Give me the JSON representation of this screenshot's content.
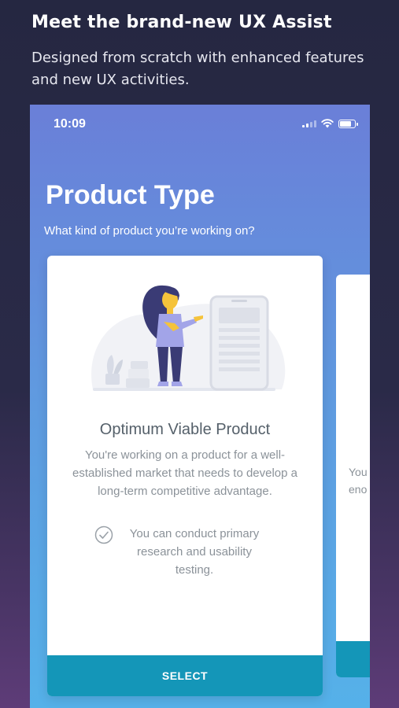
{
  "promo": {
    "title": "Meet the brand-new UX Assist",
    "subtitle": "Designed from scratch with enhanced features and new UX activities."
  },
  "status_bar": {
    "time": "10:09",
    "icons": [
      "signal-icon",
      "wifi-icon",
      "battery-icon"
    ]
  },
  "screen": {
    "title": "Product Type",
    "subtitle": "What kind of product you’re working on?"
  },
  "card": {
    "title": "Optimum Viable Product",
    "description": "You're working on a product for a well-established market that needs to develop a long-term competitive advantage.",
    "benefit": "You can conduct primary research and usability testing.",
    "button_label": "SELECT"
  },
  "peek_card": {
    "line1": "You",
    "line2": "eno"
  },
  "colors": {
    "accent": "#1496b8",
    "phone_gradient_top": "#6a7fd8",
    "phone_gradient_bottom": "#55b1e9",
    "illustration_purple": "#3a3b75",
    "illustration_yellow": "#f5c33b"
  }
}
